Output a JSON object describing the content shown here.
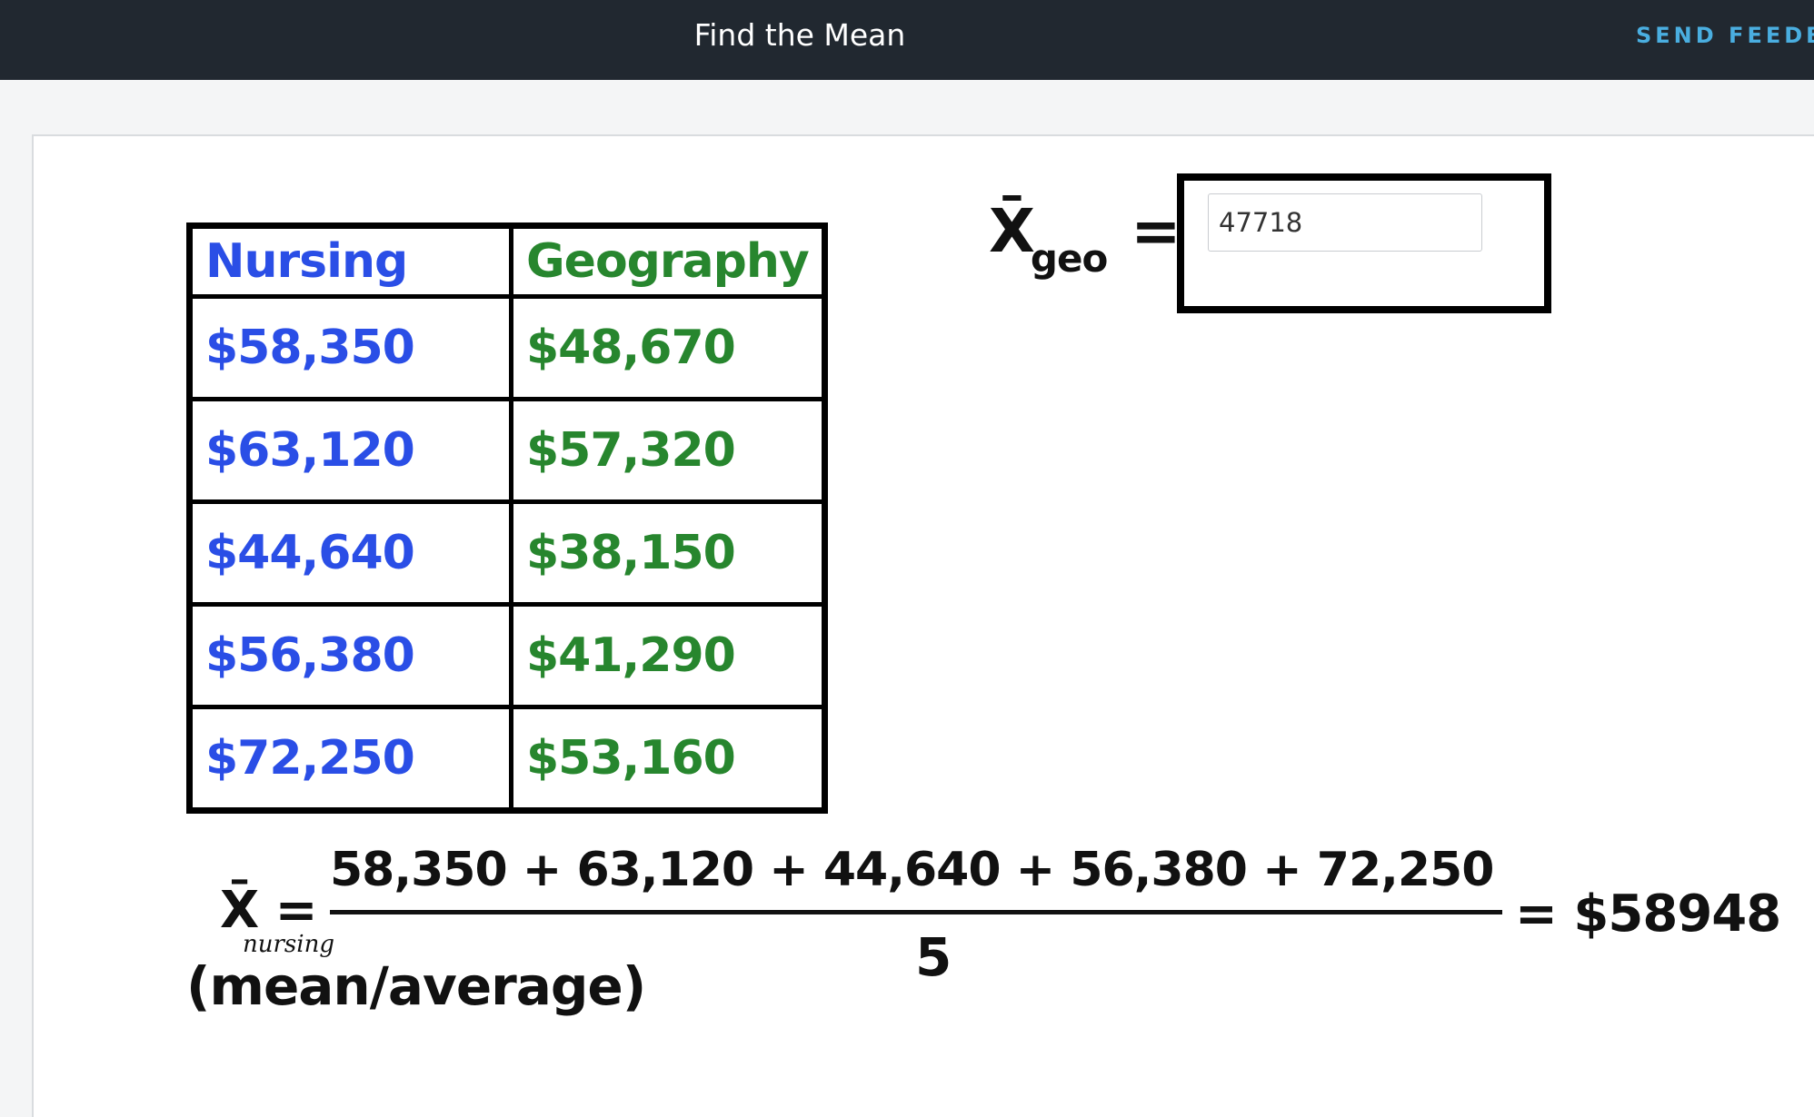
{
  "header": {
    "title": "Find the Mean",
    "feedback_label": "SEND FEEDBA"
  },
  "table": {
    "headers": [
      "Nursing",
      "Geography"
    ],
    "rows": [
      [
        "$58,350",
        "$48,670"
      ],
      [
        "$63,120",
        "$57,320"
      ],
      [
        "$44,640",
        "$38,150"
      ],
      [
        "$56,380",
        "$41,290"
      ],
      [
        "$72,250",
        "$53,160"
      ]
    ]
  },
  "geo_mean": {
    "symbol": "X̄",
    "subscript": "geo",
    "equals": "=",
    "input_value": "47718"
  },
  "formula": {
    "symbol": "X̄ =",
    "subscript": "nursing",
    "numerator": "58,350 + 63,120 + 44,640 + 56,380 + 72,250",
    "denominator": "5",
    "result": "= $58948",
    "note": "(mean/average)"
  },
  "colors": {
    "header_bg": "#212830",
    "nursing_ink": "#2a4ee6",
    "geography_ink": "#27862e",
    "feedback_link": "#4aaee0"
  }
}
